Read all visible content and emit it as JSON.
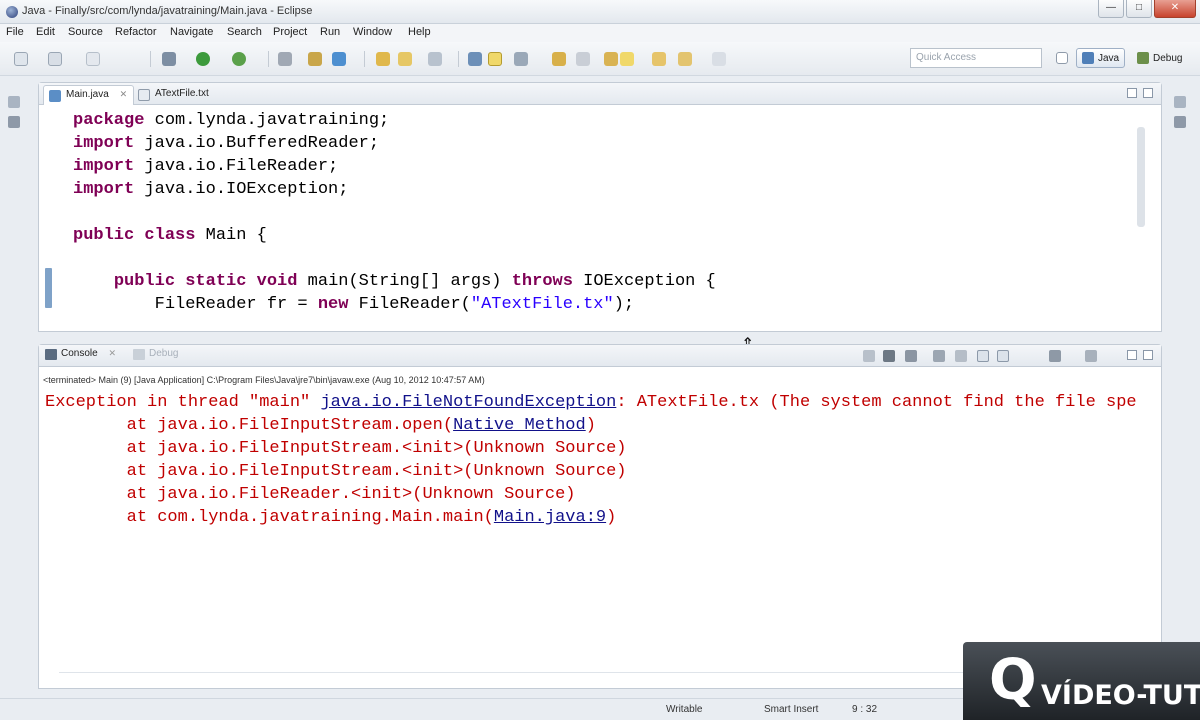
{
  "window": {
    "title": "Java - Finally/src/com/lynda/javatraining/Main.java - Eclipse",
    "controls": [
      "—",
      "□",
      "✕"
    ]
  },
  "menu": [
    "File",
    "Edit",
    "Source",
    "Refactor",
    "Navigate",
    "Search",
    "Project",
    "Run",
    "Window",
    "Help"
  ],
  "toolbar": {
    "quick_access_placeholder": "Quick Access",
    "perspectives": [
      {
        "label": "Java",
        "active": true
      },
      {
        "label": "Debug",
        "active": false
      }
    ]
  },
  "editor": {
    "tabs": [
      {
        "label": "Main.java",
        "close": "✕",
        "active": true
      },
      {
        "label": "ATextFile.txt",
        "close": "",
        "active": false
      }
    ],
    "code_lines": [
      [
        {
          "t": "package",
          "c": "kw"
        },
        {
          "t": " com.lynda.javatraining;"
        }
      ],
      [
        {
          "t": "import",
          "c": "kw"
        },
        {
          "t": " java.io.BufferedReader;"
        }
      ],
      [
        {
          "t": "import",
          "c": "kw"
        },
        {
          "t": " java.io.FileReader;"
        }
      ],
      [
        {
          "t": "import",
          "c": "kw"
        },
        {
          "t": " java.io.IOException;"
        }
      ],
      [],
      [
        {
          "t": "public",
          "c": "kw"
        },
        {
          "t": " "
        },
        {
          "t": "class",
          "c": "kw"
        },
        {
          "t": " Main {"
        }
      ],
      [],
      [
        {
          "t": "    "
        },
        {
          "t": "public",
          "c": "kw"
        },
        {
          "t": " "
        },
        {
          "t": "static",
          "c": "kw"
        },
        {
          "t": " "
        },
        {
          "t": "void",
          "c": "kw"
        },
        {
          "t": " main(String[] args) "
        },
        {
          "t": "throws",
          "c": "kw"
        },
        {
          "t": " IOException {"
        }
      ],
      [
        {
          "t": "        FileReader fr = "
        },
        {
          "t": "new",
          "c": "kw"
        },
        {
          "t": " FileReader("
        },
        {
          "t": "\"ATextFile.tx\"",
          "c": "str"
        },
        {
          "t": ");"
        }
      ]
    ]
  },
  "console": {
    "tabs": [
      {
        "label": "Console",
        "close": "✕",
        "active": true
      },
      {
        "label": "Debug",
        "active": false
      }
    ],
    "description": "<terminated> Main (9) [Java Application] C:\\Program Files\\Java\\jre7\\bin\\javaw.exe (Aug 10, 2012 10:47:57 AM)",
    "lines": [
      [
        {
          "t": "Exception in thread \"main\" "
        },
        {
          "t": "java.io.FileNotFoundException",
          "c": "lnk"
        },
        {
          "t": ": ATextFile.tx (The system cannot find the file spe"
        }
      ],
      [
        {
          "t": "        at java.io.FileInputStream.open("
        },
        {
          "t": "Native Method",
          "c": "lnk"
        },
        {
          "t": ")"
        }
      ],
      [
        {
          "t": "        at java.io.FileInputStream.<init>(Unknown Source)"
        }
      ],
      [
        {
          "t": "        at java.io.FileInputStream.<init>(Unknown Source)"
        }
      ],
      [
        {
          "t": "        at java.io.FileReader.<init>(Unknown Source)"
        }
      ],
      [
        {
          "t": "        at com.lynda.javatraining.Main.main("
        },
        {
          "t": "Main.java:9",
          "c": "lnk"
        },
        {
          "t": ")"
        }
      ]
    ]
  },
  "status_bar": {
    "mode": "Writable",
    "insert": "Smart Insert",
    "position": "9 : 32"
  },
  "watermark": {
    "mark": "Q",
    "text": "VÍDEO-TUTOR"
  }
}
